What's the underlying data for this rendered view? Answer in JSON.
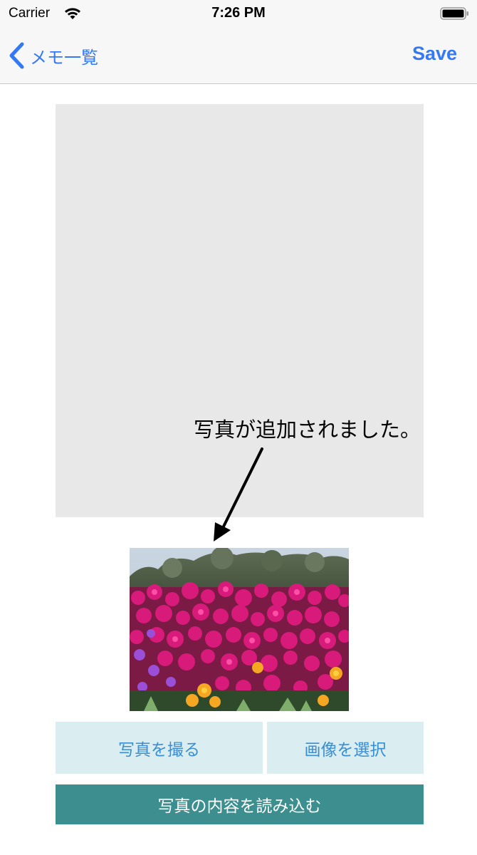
{
  "status_bar": {
    "carrier": "Carrier",
    "time": "7:26 PM",
    "wifi_icon": "wifi-icon",
    "battery_icon": "battery-icon"
  },
  "nav_bar": {
    "back_label": "メモ一覧",
    "back_icon": "chevron-left-icon",
    "save_label": "Save",
    "tint_color": "#3478f6"
  },
  "content": {
    "annotation": "写真が追加されました。",
    "photo_alt": "flowers-photo"
  },
  "buttons": {
    "take_photo": "写真を撮る",
    "select_image": "画像を選択",
    "read_photo": "写真の内容を読み込む",
    "light_button_color": "#daeef2",
    "dark_button_color": "#3d8f8f"
  }
}
